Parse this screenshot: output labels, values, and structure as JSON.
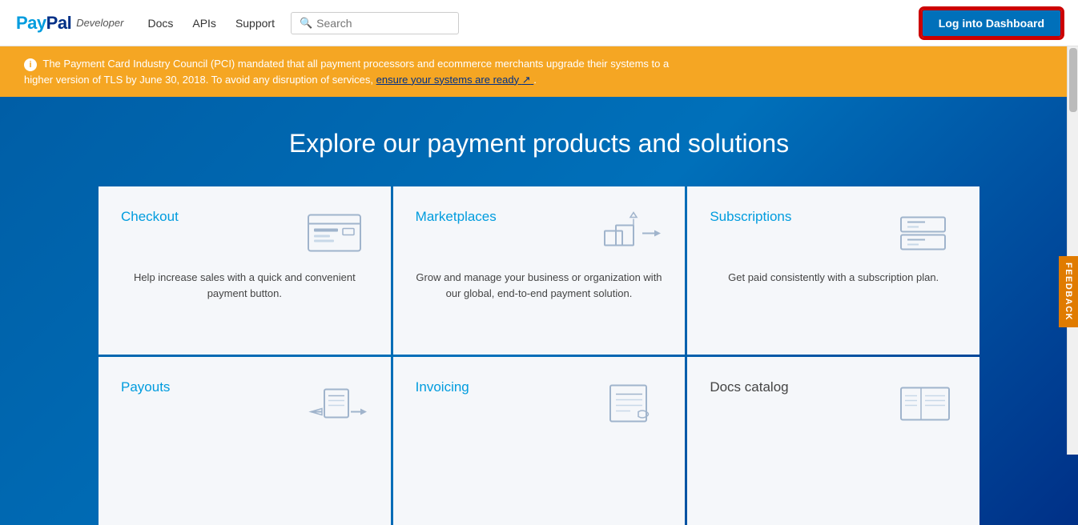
{
  "navbar": {
    "logo": {
      "pay": "Pay",
      "pal": "Pal",
      "developer": "Developer"
    },
    "links": [
      {
        "label": "Docs",
        "id": "docs"
      },
      {
        "label": "APIs",
        "id": "apis"
      },
      {
        "label": "Support",
        "id": "support"
      }
    ],
    "search": {
      "placeholder": "Search"
    },
    "login_button": "Log into Dashboard"
  },
  "alert": {
    "icon": "ℹ",
    "text1": "The Payment Card Industry Council (PCI) mandated that all payment processors and ecommerce merchants upgrade their systems to a",
    "text2": "higher version of TLS by June 30, 2018. To avoid any disruption of services,",
    "link_text": "ensure your systems are ready",
    "link_icon": "↗"
  },
  "hero": {
    "title": "Explore our payment products and solutions"
  },
  "cards": [
    {
      "id": "checkout",
      "title": "Checkout",
      "description": "Help increase sales with a quick and convenient payment button.",
      "icon_type": "checkout"
    },
    {
      "id": "marketplaces",
      "title": "Marketplaces",
      "description": "Grow and manage your business or organization with our global, end-to-end payment solution.",
      "icon_type": "marketplace"
    },
    {
      "id": "subscriptions",
      "title": "Subscriptions",
      "description": "Get paid consistently with a subscription plan.",
      "icon_type": "subscriptions"
    },
    {
      "id": "payouts",
      "title": "Payouts",
      "description": "",
      "icon_type": "payouts"
    },
    {
      "id": "invoicing",
      "title": "Invoicing",
      "description": "",
      "icon_type": "invoicing"
    },
    {
      "id": "docs-catalog",
      "title": "Docs catalog",
      "description": "",
      "icon_type": "docs-catalog"
    }
  ],
  "feedback": {
    "label": "FEEDBACK"
  },
  "colors": {
    "primary_blue": "#0070ba",
    "dark_blue": "#003087",
    "light_blue": "#009cde",
    "orange": "#f5a623",
    "feedback_orange": "#e07b00",
    "login_red_border": "#cc0000"
  }
}
